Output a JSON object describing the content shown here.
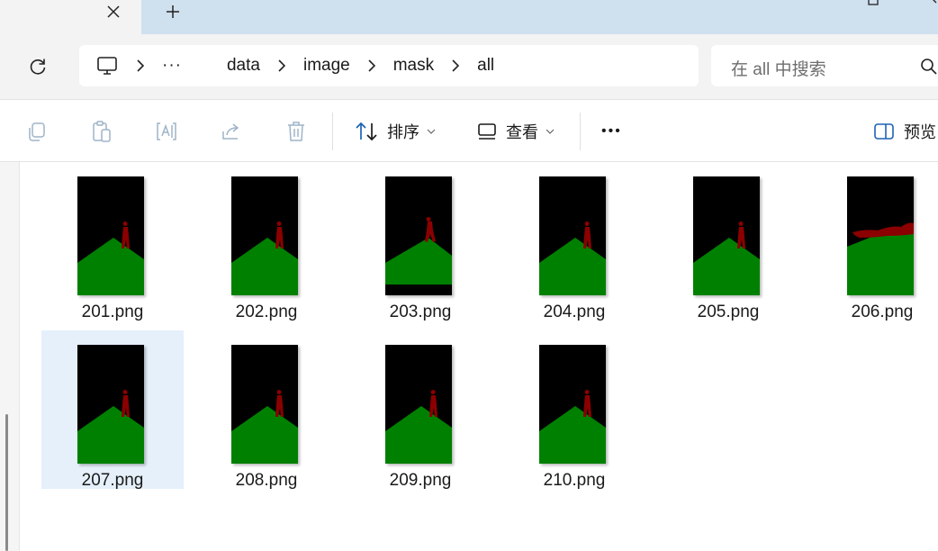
{
  "tabs": {
    "close_icon": "close-icon",
    "new_tab_icon": "plus-icon"
  },
  "address": {
    "refresh_icon": "refresh-icon",
    "root_icon": "monitor-icon",
    "overflow": "···",
    "crumbs": [
      "data",
      "image",
      "mask",
      "all"
    ]
  },
  "search": {
    "placeholder": "在 all 中搜索"
  },
  "toolbar": {
    "actions": [
      "copy-icon",
      "paste-icon",
      "rename-icon",
      "share-icon",
      "delete-icon"
    ],
    "sort_label": "排序",
    "view_label": "查看",
    "more_label": "•••",
    "preview_label": "预览"
  },
  "files": [
    {
      "name": "201.png",
      "variant": "standard"
    },
    {
      "name": "202.png",
      "variant": "standard"
    },
    {
      "name": "203.png",
      "variant": "low"
    },
    {
      "name": "204.png",
      "variant": "standard"
    },
    {
      "name": "205.png",
      "variant": "standard"
    },
    {
      "name": "206.png",
      "variant": "wide"
    },
    {
      "name": "207.png",
      "variant": "standard",
      "selected": true
    },
    {
      "name": "208.png",
      "variant": "standard"
    },
    {
      "name": "209.png",
      "variant": "standard"
    },
    {
      "name": "210.png",
      "variant": "standard"
    }
  ],
  "colors": {
    "mask_bg": "#000000",
    "ground": "#008000",
    "figure": "#8b0000",
    "selection": "#e5f0fb"
  }
}
